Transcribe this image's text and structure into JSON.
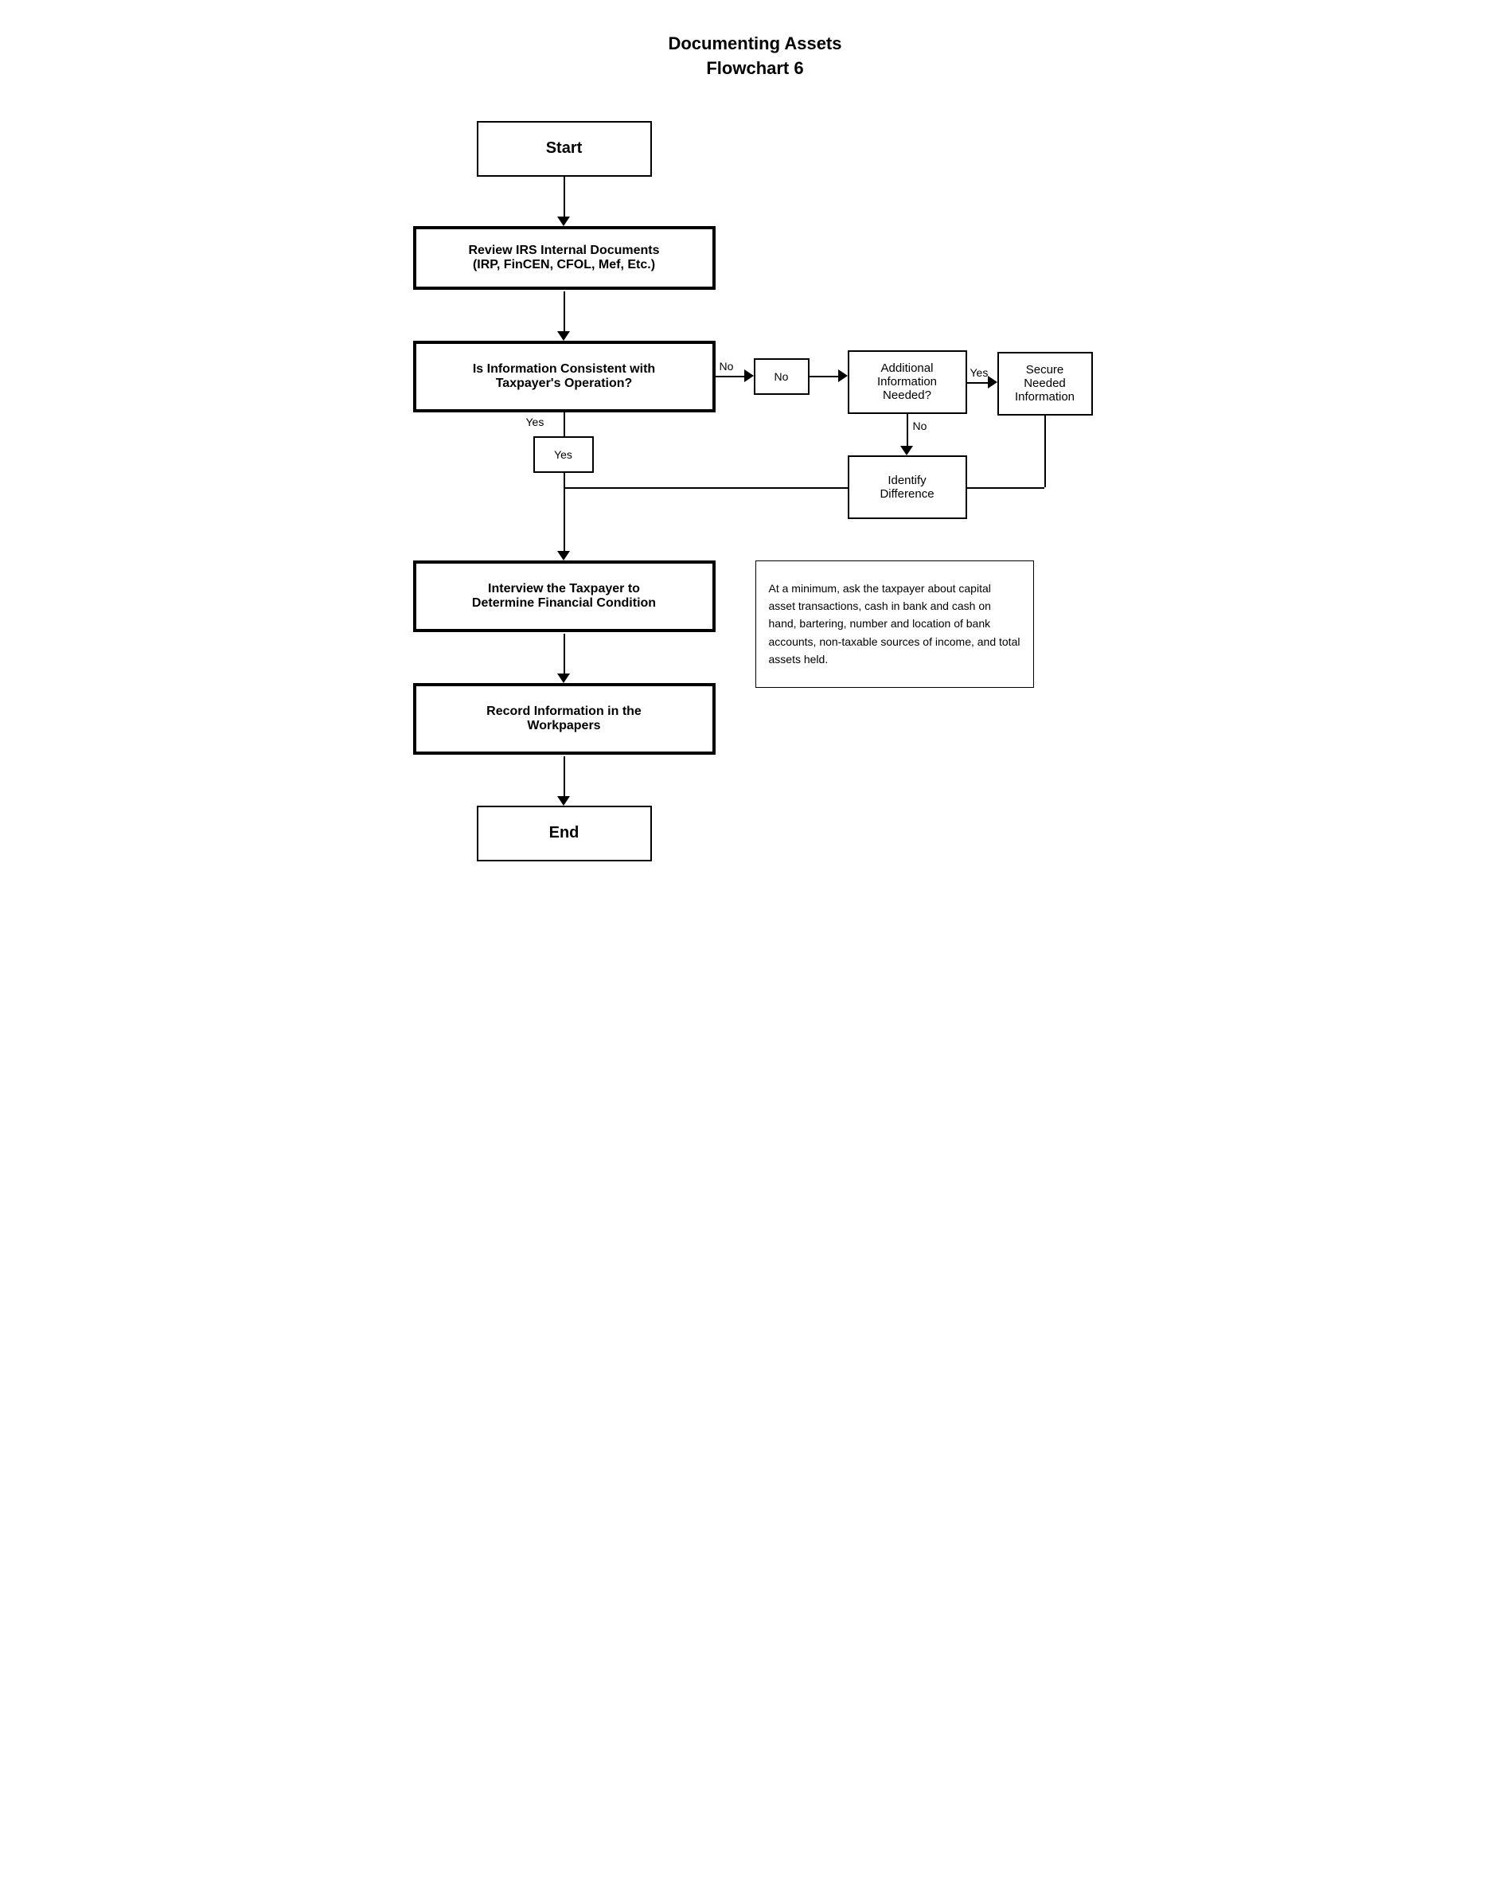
{
  "title": {
    "line1": "Documenting Assets",
    "line2": "Flowchart 6"
  },
  "nodes": {
    "start": "Start",
    "review": "Review IRS Internal Documents\n(IRP, FinCEN, CFOL, Mef, Etc.)",
    "is_consistent": "Is Information Consistent with\nTaxpayer's Operation?",
    "no_label": "No",
    "yes_label_left": "Yes",
    "yes_label_right": "Yes",
    "no_label2": "No",
    "additional_info": "Additional\nInformation\nNeeded?",
    "secure_info": "Secure\nNeeded\nInformation",
    "identify_diff": "Identify\nDifference",
    "interview": "Interview the Taxpayer to\nDetermine Financial Condition",
    "record_info": "Record Information in the\nWorkpapers",
    "end": "End",
    "note_text": "At a minimum, ask the taxpayer about capital asset transactions, cash in bank and cash on hand, bartering, number and location of bank accounts, non-taxable sources of income, and total assets held."
  }
}
